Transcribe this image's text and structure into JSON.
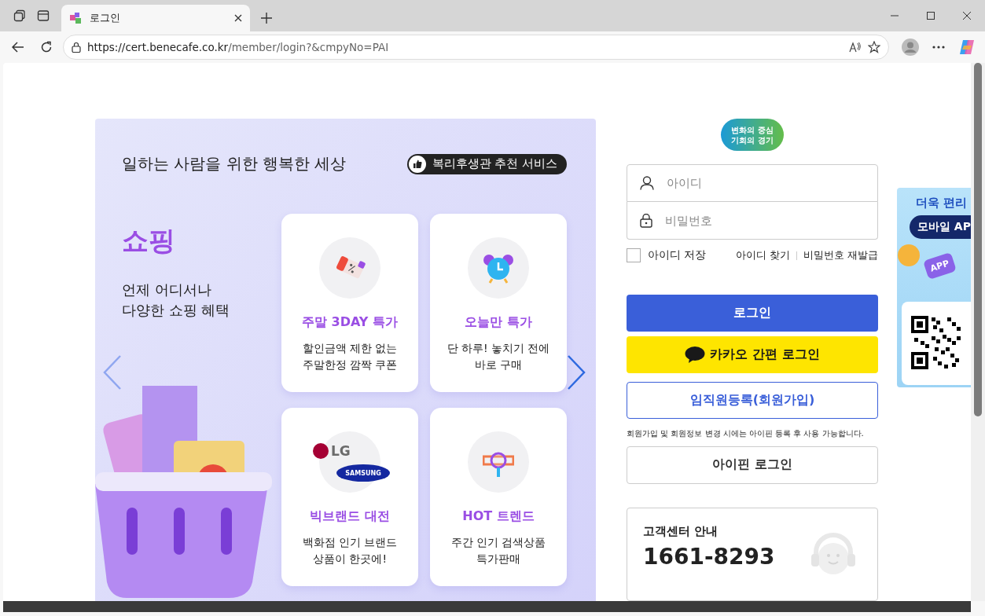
{
  "browser": {
    "tabs": [
      {
        "title": "로그인",
        "selected": true
      }
    ],
    "url_host": "https://cert.benecafe.co.kr",
    "url_path": "/member/login?&cmpyNo=PAI"
  },
  "banner": {
    "headline": "일하는 사람을 위한 행복한 세상",
    "badge": "복리후생관 추천 서비스",
    "category": "쇼핑",
    "description": "언제 어디서나\n다양한 쇼핑 혜택",
    "cards": [
      {
        "kind": "coupon",
        "title": "주말 3DAY 특가",
        "text": "할인금액 제한 없는\n주말한정 깜짝 쿠폰"
      },
      {
        "kind": "clock",
        "title": "오늘만 특가",
        "text": "단 하루! 놓치기 전에\n바로 구매"
      },
      {
        "kind": "brands",
        "logos": [
          "LG",
          "SAMSUNG"
        ],
        "title": "빅브랜드 대전",
        "text": "백화점 인기 브랜드\n상품이 한곳에!"
      },
      {
        "kind": "search",
        "title": "HOT 트렌드",
        "text": "주간 인기 검색상품\n특가판매"
      }
    ]
  },
  "login": {
    "logo_lines": [
      "변화의 중심",
      "기회의 경기"
    ],
    "id_placeholder": "아이디",
    "password_placeholder": "비밀번호",
    "remember": {
      "label": "아이디 저장",
      "checked": false
    },
    "links": [
      "아이디 찾기",
      "비밀번호 재발급"
    ],
    "buttons": [
      {
        "kind": "primary",
        "label": "로그인"
      },
      {
        "kind": "kakao",
        "label": "카카오 간편 로그인"
      },
      {
        "kind": "outline",
        "label": "임직원등록(회원가입)"
      }
    ],
    "notice": "회원가입 및 회원정보 변경 시에는 아이핀 등록 후 사용 가능합니다.",
    "ipin_button": "아이핀 로그인",
    "support": {
      "title": "고객센터 안내",
      "phone": "1661-8293"
    }
  },
  "side_ad": {
    "headline": "더욱 편리",
    "pill": "모바일 AP",
    "app_label": "APP"
  }
}
